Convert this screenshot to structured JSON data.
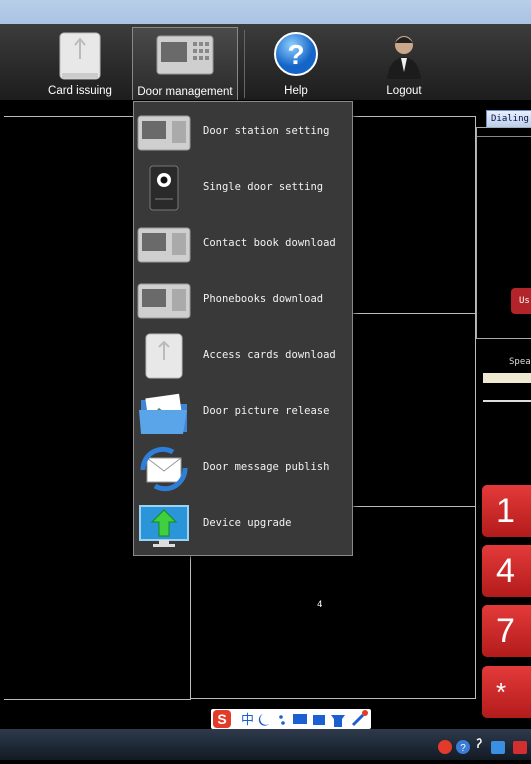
{
  "toolbar": {
    "buttons": [
      {
        "label": "Card issuing",
        "icon": "card-reader-icon"
      },
      {
        "label": "Door management",
        "icon": "door-station-icon"
      },
      {
        "label": "Help",
        "icon": "help-icon"
      },
      {
        "label": "Logout",
        "icon": "user-logout-icon"
      }
    ]
  },
  "menu": {
    "items": [
      {
        "label": "Door station setting",
        "icon": "door-station-icon"
      },
      {
        "label": "Single door setting",
        "icon": "door-camera-icon"
      },
      {
        "label": "Contact book download",
        "icon": "door-station-icon"
      },
      {
        "label": "Phonebooks download",
        "icon": "door-station-icon"
      },
      {
        "label": "Access cards download",
        "icon": "card-reader-icon"
      },
      {
        "label": "Door picture release",
        "icon": "picture-folder-icon"
      },
      {
        "label": "Door message publish",
        "icon": "message-sync-icon"
      },
      {
        "label": "Device upgrade",
        "icon": "upgrade-monitor-icon"
      }
    ]
  },
  "panes": {
    "pane4_number": "4"
  },
  "dialing": {
    "tab_label": "Dialing",
    "use_button": "Us",
    "speaker_label": "Spea"
  },
  "keypad": {
    "keys": [
      "1",
      "4",
      "7",
      "*"
    ]
  },
  "ime": {
    "char": "中"
  },
  "colors": {
    "key_red": "#d42a2a",
    "toolbar_bg": "#2a2a2a",
    "menu_bg": "#393939"
  }
}
